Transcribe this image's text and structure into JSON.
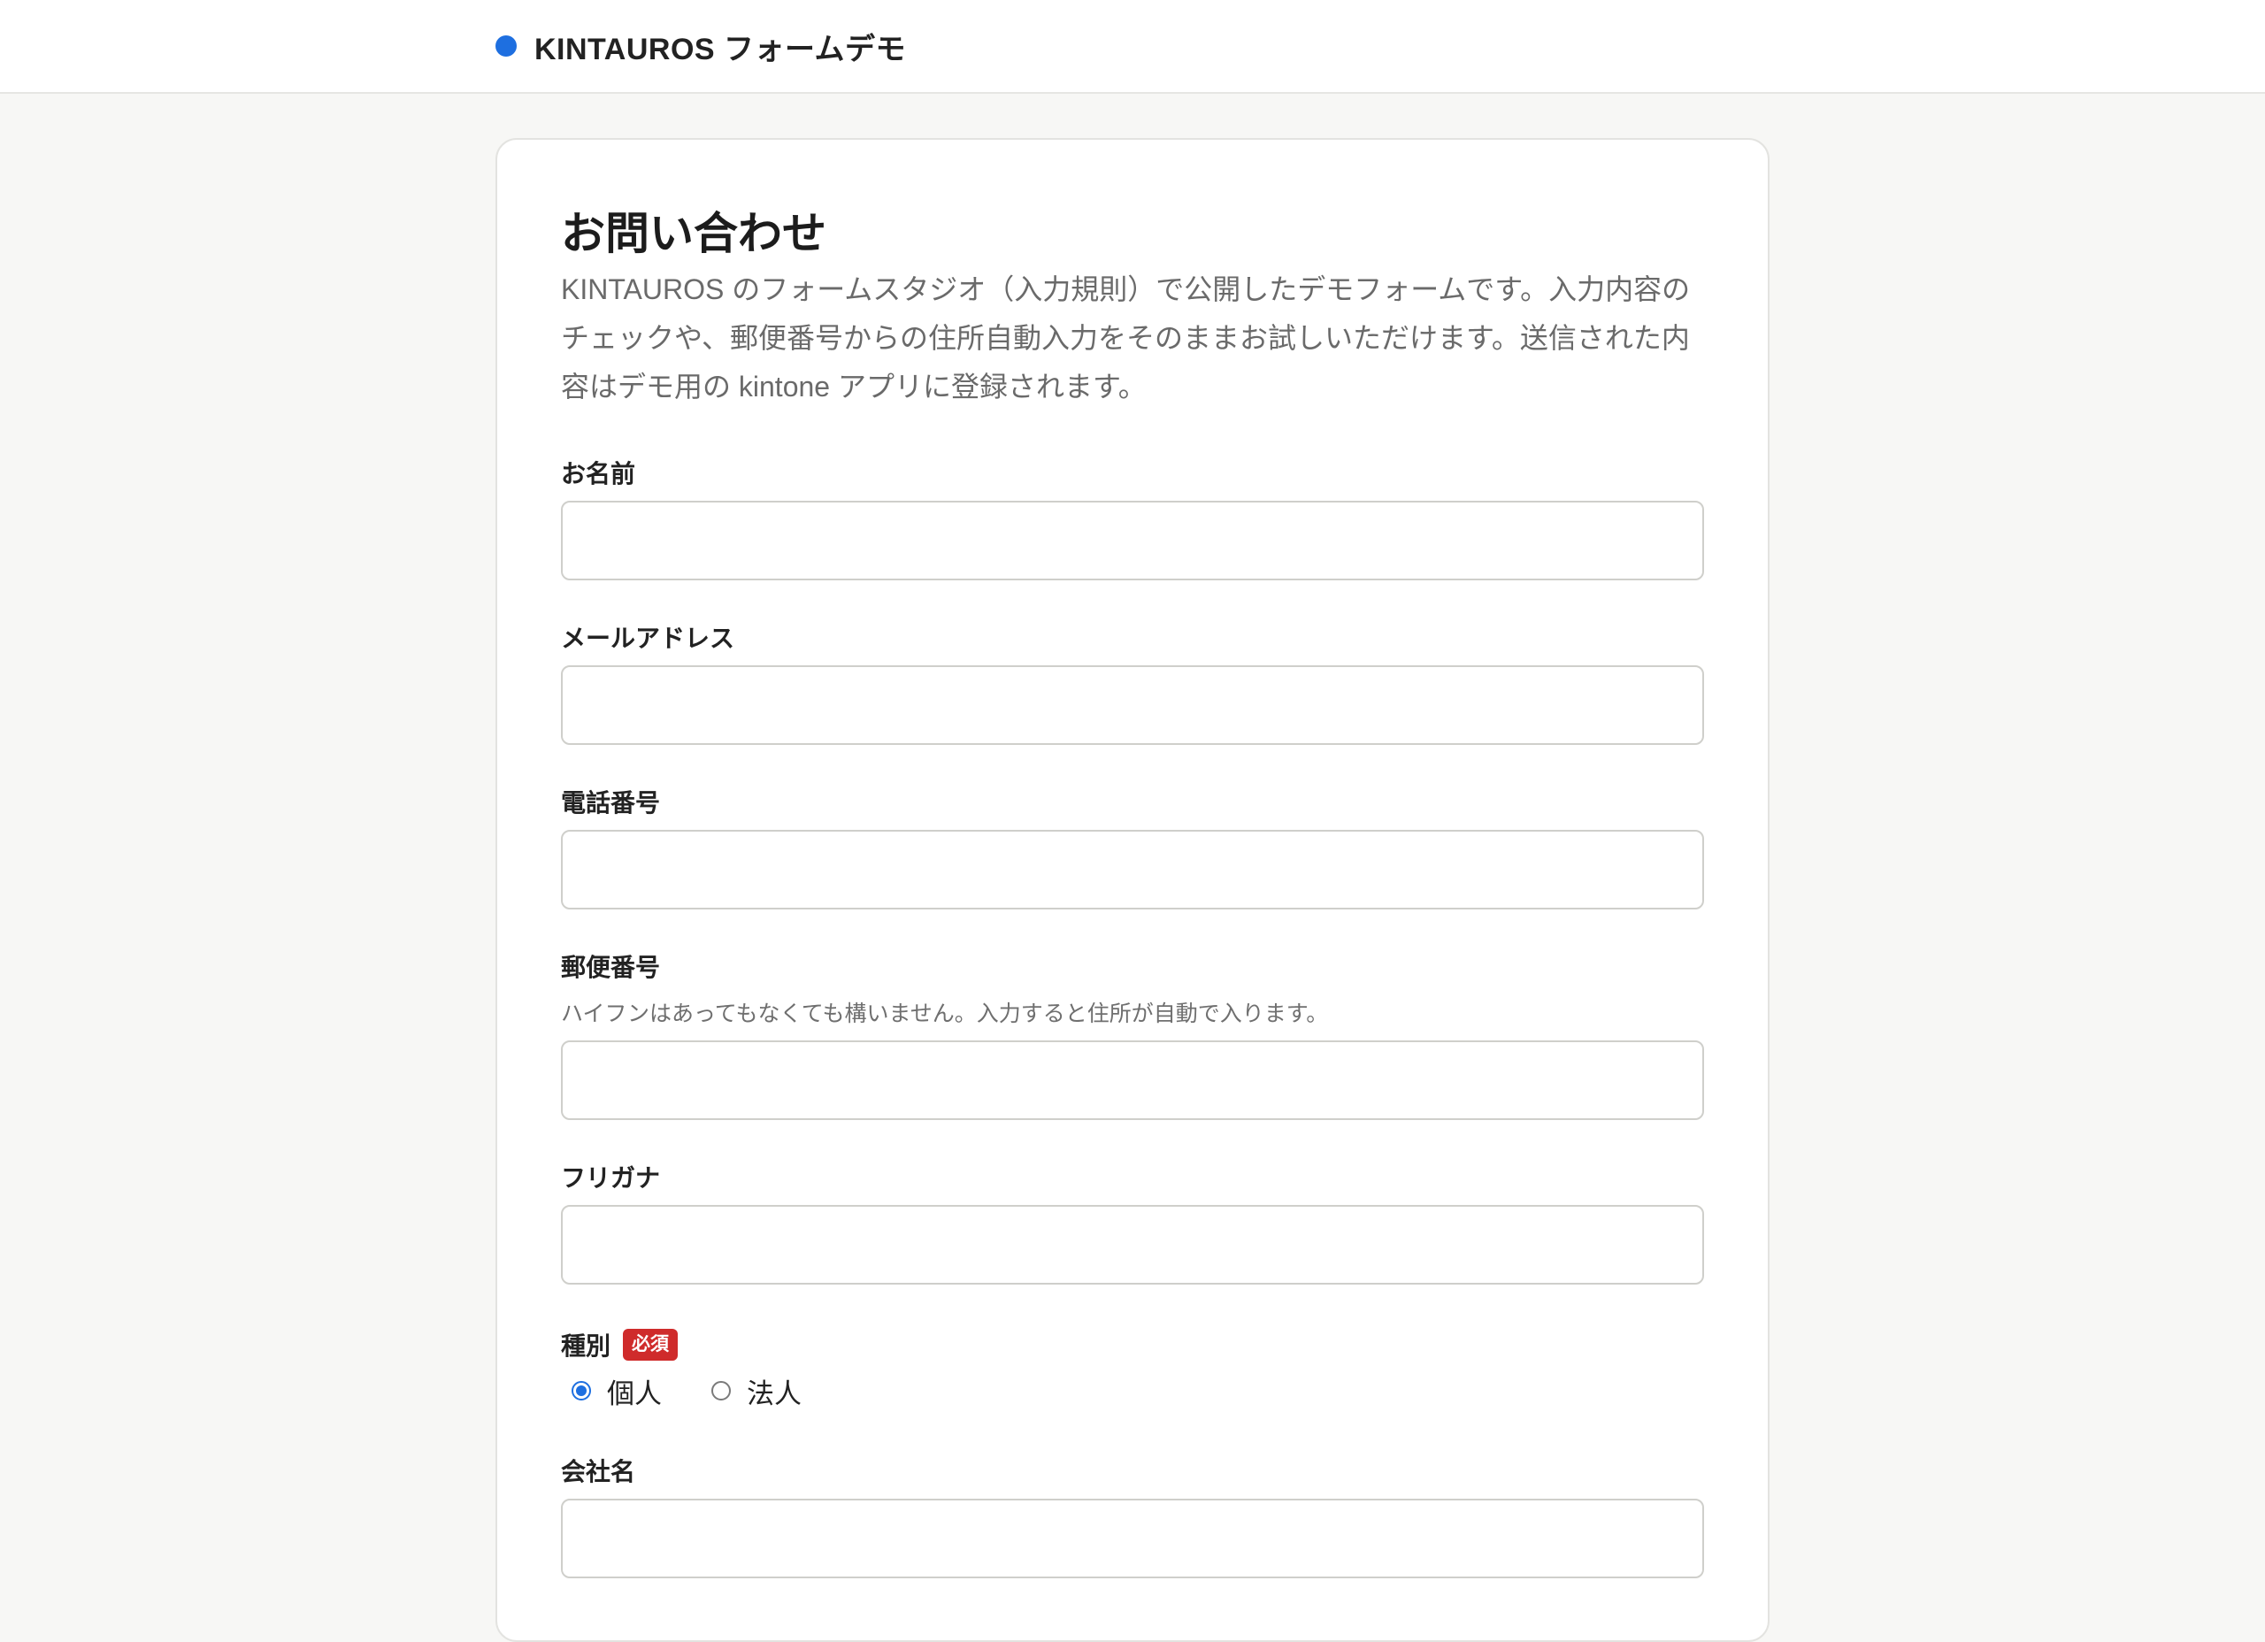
{
  "header": {
    "brand_title": "KINTAUROS フォームデモ",
    "accent_color": "#1e6fe0"
  },
  "form": {
    "title": "お問い合わせ",
    "description": "KINTAUROS のフォームスタジオ（入力規則）で公開したデモフォームです。入力内容のチェックや、郵便番号からの住所自動入力をそのままお試しいただけます。送信された内容はデモ用の kintone アプリに登録されます。",
    "fields": {
      "name": {
        "label": "お名前",
        "value": ""
      },
      "email": {
        "label": "メールアドレス",
        "value": ""
      },
      "phone": {
        "label": "電話番号",
        "value": ""
      },
      "postal": {
        "label": "郵便番号",
        "hint": "ハイフンはあってもなくても構いません。入力すると住所が自動で入ります。",
        "value": ""
      },
      "furigana": {
        "label": "フリガナ",
        "value": ""
      },
      "type": {
        "label": "種別",
        "required_badge": "必須",
        "options": [
          {
            "label": "個人",
            "selected": true
          },
          {
            "label": "法人",
            "selected": false
          }
        ]
      },
      "company": {
        "label": "会社名",
        "value": ""
      }
    }
  }
}
